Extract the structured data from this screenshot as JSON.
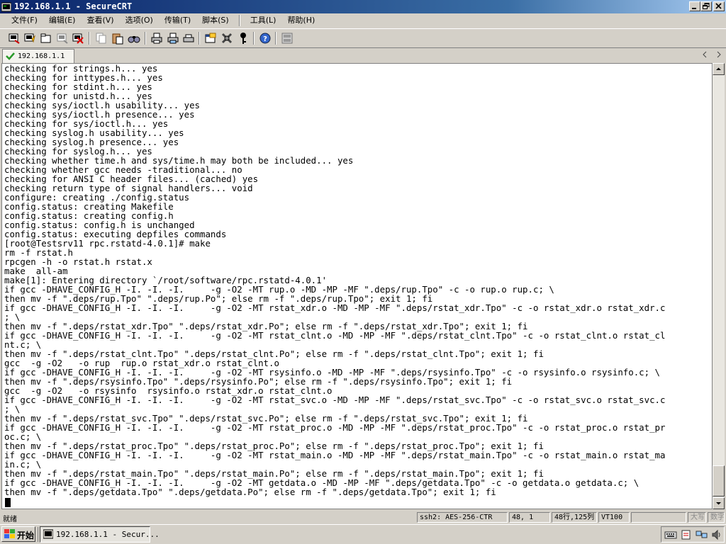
{
  "window": {
    "title": "192.168.1.1 - SecureCRT"
  },
  "menu": {
    "items": [
      "文件(F)",
      "编辑(E)",
      "查看(V)",
      "选项(O)",
      "传输(T)",
      "脚本(S)",
      "工具(L)",
      "帮助(H)"
    ]
  },
  "toolbar": {
    "icons": [
      "connect-icon",
      "quick-connect-icon",
      "connect-tab-icon",
      "reconnect-icon",
      "disconnect-icon",
      "copy-icon",
      "paste-icon",
      "find-icon",
      "print-icon",
      "print-selection-icon",
      "print-setup-icon",
      "session-options-icon",
      "global-options-icon",
      "key-gen-icon",
      "help-icon",
      "keymap-icon"
    ]
  },
  "tab": {
    "label": "192.168.1.1"
  },
  "terminal": {
    "lines": [
      "checking for strings.h... yes",
      "checking for inttypes.h... yes",
      "checking for stdint.h... yes",
      "checking for unistd.h... yes",
      "checking sys/ioctl.h usability... yes",
      "checking sys/ioctl.h presence... yes",
      "checking for sys/ioctl.h... yes",
      "checking syslog.h usability... yes",
      "checking syslog.h presence... yes",
      "checking for syslog.h... yes",
      "checking whether time.h and sys/time.h may both be included... yes",
      "checking whether gcc needs -traditional... no",
      "checking for ANSI C header files... (cached) yes",
      "checking return type of signal handlers... void",
      "configure: creating ./config.status",
      "config.status: creating Makefile",
      "config.status: creating config.h",
      "config.status: config.h is unchanged",
      "config.status: executing depfiles commands",
      "[root@Testsrv11 rpc.rstatd-4.0.1]# make",
      "rm -f rstat.h",
      "rpcgen -h -o rstat.h rstat.x",
      "make  all-am",
      "make[1]: Entering directory `/root/software/rpc.rstatd-4.0.1'",
      "if gcc -DHAVE_CONFIG_H -I. -I. -I.     -g -O2 -MT rup.o -MD -MP -MF \".deps/rup.Tpo\" -c -o rup.o rup.c; \\",
      "then mv -f \".deps/rup.Tpo\" \".deps/rup.Po\"; else rm -f \".deps/rup.Tpo\"; exit 1; fi",
      "if gcc -DHAVE_CONFIG_H -I. -I. -I.     -g -O2 -MT rstat_xdr.o -MD -MP -MF \".deps/rstat_xdr.Tpo\" -c -o rstat_xdr.o rstat_xdr.c",
      "; \\",
      "then mv -f \".deps/rstat_xdr.Tpo\" \".deps/rstat_xdr.Po\"; else rm -f \".deps/rstat_xdr.Tpo\"; exit 1; fi",
      "if gcc -DHAVE_CONFIG_H -I. -I. -I.     -g -O2 -MT rstat_clnt.o -MD -MP -MF \".deps/rstat_clnt.Tpo\" -c -o rstat_clnt.o rstat_cl",
      "nt.c; \\",
      "then mv -f \".deps/rstat_clnt.Tpo\" \".deps/rstat_clnt.Po\"; else rm -f \".deps/rstat_clnt.Tpo\"; exit 1; fi",
      "gcc  -g -O2   -o rup  rup.o rstat_xdr.o rstat_clnt.o",
      "if gcc -DHAVE_CONFIG_H -I. -I. -I.     -g -O2 -MT rsysinfo.o -MD -MP -MF \".deps/rsysinfo.Tpo\" -c -o rsysinfo.o rsysinfo.c; \\",
      "then mv -f \".deps/rsysinfo.Tpo\" \".deps/rsysinfo.Po\"; else rm -f \".deps/rsysinfo.Tpo\"; exit 1; fi",
      "gcc  -g -O2   -o rsysinfo  rsysinfo.o rstat_xdr.o rstat_clnt.o",
      "if gcc -DHAVE_CONFIG_H -I. -I. -I.     -g -O2 -MT rstat_svc.o -MD -MP -MF \".deps/rstat_svc.Tpo\" -c -o rstat_svc.o rstat_svc.c",
      "; \\",
      "then mv -f \".deps/rstat_svc.Tpo\" \".deps/rstat_svc.Po\"; else rm -f \".deps/rstat_svc.Tpo\"; exit 1; fi",
      "if gcc -DHAVE_CONFIG_H -I. -I. -I.     -g -O2 -MT rstat_proc.o -MD -MP -MF \".deps/rstat_proc.Tpo\" -c -o rstat_proc.o rstat_pr",
      "oc.c; \\",
      "then mv -f \".deps/rstat_proc.Tpo\" \".deps/rstat_proc.Po\"; else rm -f \".deps/rstat_proc.Tpo\"; exit 1; fi",
      "if gcc -DHAVE_CONFIG_H -I. -I. -I.     -g -O2 -MT rstat_main.o -MD -MP -MF \".deps/rstat_main.Tpo\" -c -o rstat_main.o rstat_ma",
      "in.c; \\",
      "then mv -f \".deps/rstat_main.Tpo\" \".deps/rstat_main.Po\"; else rm -f \".deps/rstat_main.Tpo\"; exit 1; fi",
      "if gcc -DHAVE_CONFIG_H -I. -I. -I.     -g -O2 -MT getdata.o -MD -MP -MF \".deps/getdata.Tpo\" -c -o getdata.o getdata.c; \\",
      "then mv -f \".deps/getdata.Tpo\" \".deps/getdata.Po\"; else rm -f \".deps/getdata.Tpo\"; exit 1; fi"
    ]
  },
  "statusbar": {
    "ready": "就绪",
    "protocol": "ssh2: AES-256-CTR",
    "position": "48,    1",
    "size": "48行,125列",
    "terminal_type": "VT100",
    "empty": "",
    "caps": "大写",
    "num": "数字"
  },
  "taskbar": {
    "start_label": "开始",
    "task_label": "192.168.1.1 - Secur..."
  },
  "colors": {
    "title_start": "#0a246a",
    "title_end": "#a6caf0",
    "chrome": "#d4d0c8",
    "terminal_bg": "#ffffff",
    "terminal_fg": "#000000"
  }
}
